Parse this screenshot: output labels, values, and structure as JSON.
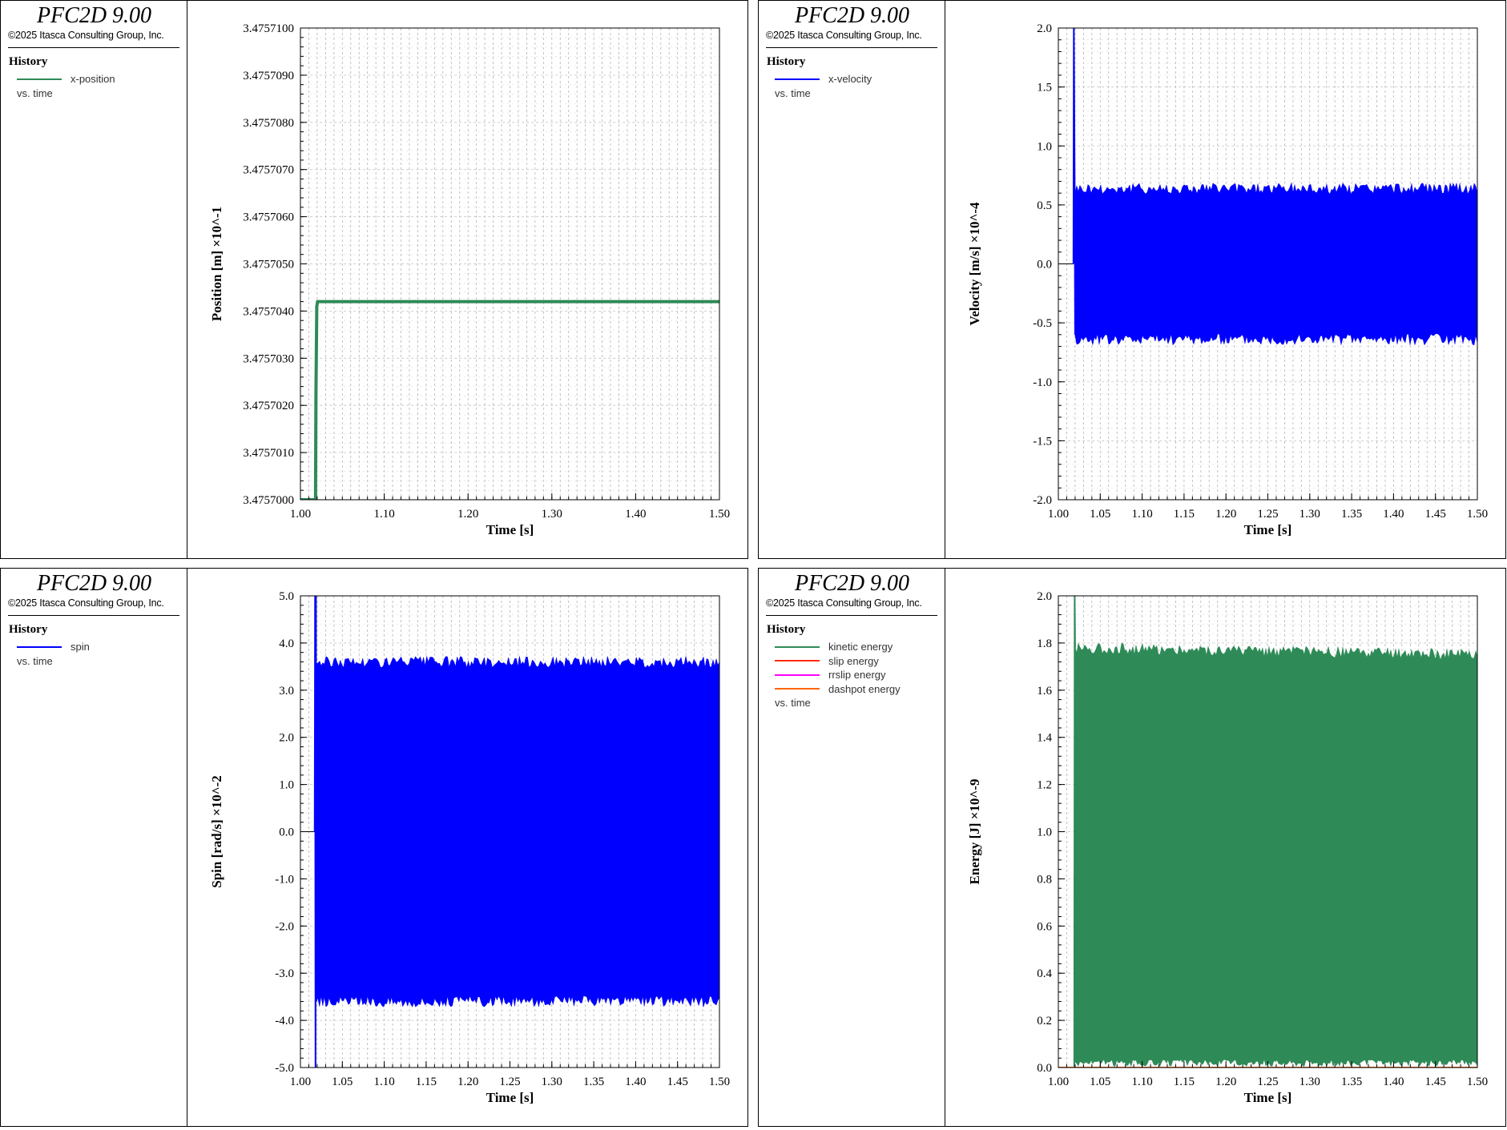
{
  "panels": [
    {
      "app_title": "PFC2D 9.00",
      "copyright": "©2025 Itasca Consulting Group, Inc.",
      "history_heading": "History",
      "legend": [
        {
          "label": "x-position",
          "color": "#2e8b57"
        }
      ],
      "vs_label": "vs. time"
    },
    {
      "app_title": "PFC2D 9.00",
      "copyright": "©2025 Itasca Consulting Group, Inc.",
      "history_heading": "History",
      "legend": [
        {
          "label": "x-velocity",
          "color": "#0000ff"
        }
      ],
      "vs_label": "vs. time"
    },
    {
      "app_title": "PFC2D 9.00",
      "copyright": "©2025 Itasca Consulting Group, Inc.",
      "history_heading": "History",
      "legend": [
        {
          "label": "spin",
          "color": "#0000ff"
        }
      ],
      "vs_label": "vs. time"
    },
    {
      "app_title": "PFC2D 9.00",
      "copyright": "©2025 Itasca Consulting Group, Inc.",
      "history_heading": "History",
      "legend": [
        {
          "label": "kinetic energy",
          "color": "#2e8b57"
        },
        {
          "label": "slip energy",
          "color": "#ff2a00"
        },
        {
          "label": "rrslip energy",
          "color": "#ff00ff"
        },
        {
          "label": "dashpot energy",
          "color": "#ff6600"
        }
      ],
      "vs_label": "vs. time"
    }
  ],
  "chart_data": [
    {
      "type": "line",
      "xlabel": "Time [s]",
      "ylabel": "Position [m] ×10^-1",
      "xlim": [
        1.0,
        1.5
      ],
      "ylim": [
        3.4757,
        3.47571
      ],
      "x_ticks": [
        "1.00",
        "1.10",
        "1.20",
        "1.30",
        "1.40",
        "1.50"
      ],
      "x_tick_values": [
        1.0,
        1.1,
        1.2,
        1.3,
        1.4,
        1.5
      ],
      "y_ticks": [
        "3.4757000",
        "3.4757010",
        "3.4757020",
        "3.4757030",
        "3.4757040",
        "3.4757050",
        "3.4757060",
        "3.4757070",
        "3.4757080",
        "3.4757090",
        "3.4757100"
      ],
      "y_tick_values": [
        3.4757,
        3.475701,
        3.475702,
        3.475703,
        3.475704,
        3.475705,
        3.475706,
        3.475707,
        3.475708,
        3.475709,
        3.47571
      ],
      "grid": true,
      "series": [
        {
          "name": "x-position",
          "color": "#2e8b57",
          "x": [
            1.0,
            1.018,
            1.0185,
            1.0195,
            1.0205,
            1.03,
            1.1,
            1.2,
            1.3,
            1.4,
            1.5
          ],
          "y": [
            3.4757,
            3.4757,
            3.4757022,
            3.4757041,
            3.4757042,
            3.4757042,
            3.4757042,
            3.4757042,
            3.4757042,
            3.4757042,
            3.4757042
          ],
          "band": 1e-07
        }
      ]
    },
    {
      "type": "line",
      "xlabel": "Time [s]",
      "ylabel": "Velocity [m/s] ×10^-4",
      "xlim": [
        1.0,
        1.5
      ],
      "ylim": [
        -2.0,
        2.0
      ],
      "x_ticks": [
        "1.00",
        "1.05",
        "1.10",
        "1.15",
        "1.20",
        "1.25",
        "1.30",
        "1.35",
        "1.40",
        "1.45",
        "1.50"
      ],
      "x_tick_values": [
        1.0,
        1.05,
        1.1,
        1.15,
        1.2,
        1.25,
        1.3,
        1.35,
        1.4,
        1.45,
        1.5
      ],
      "y_ticks": [
        "-2.0",
        "-1.5",
        "-1.0",
        "-0.5",
        "0.0",
        "0.5",
        "1.0",
        "1.5",
        "2.0"
      ],
      "y_tick_values": [
        -2.0,
        -1.5,
        -1.0,
        -0.5,
        0.0,
        0.5,
        1.0,
        1.5,
        2.0
      ],
      "grid": true,
      "series": [
        {
          "name": "x-velocity",
          "color": "#0000ff",
          "pre_x": [
            1.0,
            1.018
          ],
          "pre_y": [
            0.0,
            0.0
          ],
          "spike_x": [
            1.018,
            1.0185,
            1.019,
            1.0195,
            1.02
          ],
          "spike_y": [
            0.0,
            2.0,
            1.3,
            0.6,
            -0.6
          ],
          "osc_start": 1.02,
          "osc_end": 1.5,
          "osc_min": -0.64,
          "osc_max": 0.64
        }
      ]
    },
    {
      "type": "line",
      "xlabel": "Time [s]",
      "ylabel": "Spin [rad/s] ×10^-2",
      "xlim": [
        1.0,
        1.5
      ],
      "ylim": [
        -5.0,
        5.0
      ],
      "x_ticks": [
        "1.00",
        "1.05",
        "1.10",
        "1.15",
        "1.20",
        "1.25",
        "1.30",
        "1.35",
        "1.40",
        "1.45",
        "1.50"
      ],
      "x_tick_values": [
        1.0,
        1.05,
        1.1,
        1.15,
        1.2,
        1.25,
        1.3,
        1.35,
        1.4,
        1.45,
        1.5
      ],
      "y_ticks": [
        "-5.0",
        "-4.0",
        "-3.0",
        "-2.0",
        "-1.0",
        "0.0",
        "1.0",
        "2.0",
        "3.0",
        "4.0",
        "5.0"
      ],
      "y_tick_values": [
        -5.0,
        -4.0,
        -3.0,
        -2.0,
        -1.0,
        0.0,
        1.0,
        2.0,
        3.0,
        4.0,
        5.0
      ],
      "grid": true,
      "series": [
        {
          "name": "spin",
          "color": "#0000ff",
          "pre_x": [
            1.0,
            1.017
          ],
          "pre_y": [
            0.0,
            0.0
          ],
          "spike_x": [
            1.017,
            1.0175,
            1.018,
            1.0185,
            1.019
          ],
          "spike_y": [
            0.0,
            5.0,
            -5.0,
            5.0,
            -3.6
          ],
          "osc_start": 1.019,
          "osc_end": 1.5,
          "osc_min": -3.6,
          "osc_max": 3.6
        }
      ]
    },
    {
      "type": "line",
      "xlabel": "Time [s]",
      "ylabel": "Energy [J] ×10^-9",
      "xlim": [
        1.0,
        1.5
      ],
      "ylim": [
        0.0,
        2.0
      ],
      "x_ticks": [
        "1.00",
        "1.05",
        "1.10",
        "1.15",
        "1.20",
        "1.25",
        "1.30",
        "1.35",
        "1.40",
        "1.45",
        "1.50"
      ],
      "x_tick_values": [
        1.0,
        1.05,
        1.1,
        1.15,
        1.2,
        1.25,
        1.3,
        1.35,
        1.4,
        1.45,
        1.5
      ],
      "y_ticks": [
        "0.0",
        "0.2",
        "0.4",
        "0.6",
        "0.8",
        "1.0",
        "1.2",
        "1.4",
        "1.6",
        "1.8",
        "2.0"
      ],
      "y_tick_values": [
        0.0,
        0.2,
        0.4,
        0.6,
        0.8,
        1.0,
        1.2,
        1.4,
        1.6,
        1.8,
        2.0
      ],
      "grid": true,
      "series": [
        {
          "name": "kinetic energy",
          "color": "#2e8b57",
          "pre_x": [
            1.0,
            1.019
          ],
          "pre_y": [
            0.0,
            0.0
          ],
          "spike_x": [
            1.019,
            1.0195,
            1.02
          ],
          "spike_y": [
            0.0,
            2.0,
            1.78
          ],
          "osc_start": 1.02,
          "osc_end": 1.5,
          "osc_min": 0.02,
          "osc_max_start": 1.78,
          "osc_max_end": 1.75
        },
        {
          "name": "slip energy",
          "color": "#ff2a00",
          "x": [
            1.0,
            1.5
          ],
          "y": [
            0.0,
            0.0
          ]
        },
        {
          "name": "rrslip energy",
          "color": "#ff00ff",
          "x": [
            1.0,
            1.5
          ],
          "y": [
            0.0,
            0.0
          ]
        },
        {
          "name": "dashpot energy",
          "color": "#ff6600",
          "x": [
            1.0,
            1.5
          ],
          "y": [
            0.0,
            0.0
          ]
        }
      ]
    }
  ]
}
